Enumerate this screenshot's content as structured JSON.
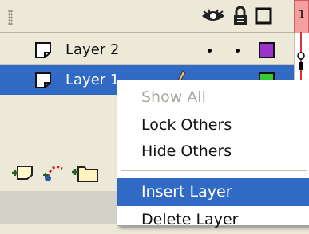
{
  "timeline": {
    "frame_number": "1"
  },
  "layers": [
    {
      "name": "Layer 2",
      "color": "#9933cc",
      "selected": false
    },
    {
      "name": "Layer 1",
      "color": "#33cc33",
      "selected": true
    }
  ],
  "context_menu": {
    "items": [
      {
        "label": "Show All",
        "disabled": true
      },
      {
        "label": "Lock Others",
        "disabled": false
      },
      {
        "label": "Hide Others",
        "disabled": false
      },
      {
        "label": "Insert Layer",
        "highlighted": true
      },
      {
        "label": "Delete Layer",
        "disabled": false
      }
    ]
  },
  "colors": {
    "selection": "#316ac5",
    "panel": "#ece9d8",
    "playhead": "#dd3333"
  }
}
